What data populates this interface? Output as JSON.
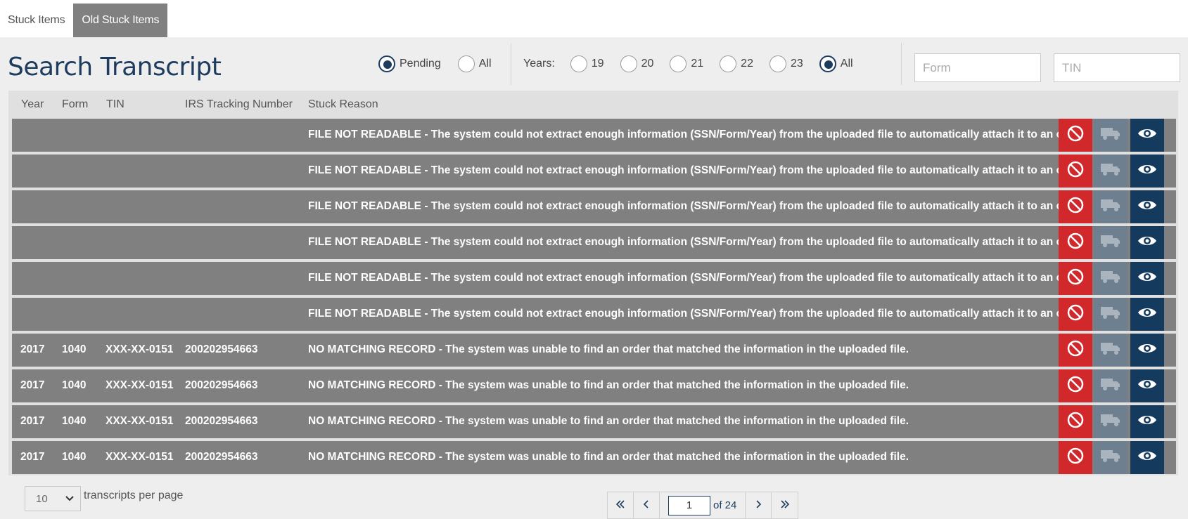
{
  "tabs": [
    {
      "label": "Stuck Items",
      "active": false
    },
    {
      "label": "Old Stuck Items",
      "active": true
    }
  ],
  "title": "Search Transcript",
  "status_filter": {
    "options": [
      "Pending",
      "All"
    ],
    "selected": "Pending"
  },
  "years_filter": {
    "label": "Years:",
    "options": [
      "19",
      "20",
      "21",
      "22",
      "23",
      "All"
    ],
    "selected": "All"
  },
  "form_input": {
    "placeholder": "Form",
    "value": ""
  },
  "tin_input": {
    "placeholder": "TIN",
    "value": ""
  },
  "table": {
    "headers": {
      "year": "Year",
      "form": "Form",
      "tin": "TIN",
      "tracking": "IRS Tracking Number",
      "reason": "Stuck Reason"
    },
    "rows": [
      {
        "year": "",
        "form": "",
        "tin": "",
        "tracking": "",
        "reason": "FILE NOT READABLE - The system could not extract enough information (SSN/Form/Year) from the uploaded file to automatically attach it to an order."
      },
      {
        "year": "",
        "form": "",
        "tin": "",
        "tracking": "",
        "reason": "FILE NOT READABLE - The system could not extract enough information (SSN/Form/Year) from the uploaded file to automatically attach it to an order."
      },
      {
        "year": "",
        "form": "",
        "tin": "",
        "tracking": "",
        "reason": "FILE NOT READABLE - The system could not extract enough information (SSN/Form/Year) from the uploaded file to automatically attach it to an order."
      },
      {
        "year": "",
        "form": "",
        "tin": "",
        "tracking": "",
        "reason": "FILE NOT READABLE - The system could not extract enough information (SSN/Form/Year) from the uploaded file to automatically attach it to an order."
      },
      {
        "year": "",
        "form": "",
        "tin": "",
        "tracking": "",
        "reason": "FILE NOT READABLE - The system could not extract enough information (SSN/Form/Year) from the uploaded file to automatically attach it to an order."
      },
      {
        "year": "",
        "form": "",
        "tin": "",
        "tracking": "",
        "reason": "FILE NOT READABLE - The system could not extract enough information (SSN/Form/Year) from the uploaded file to automatically attach it to an order."
      },
      {
        "year": "2017",
        "form": "1040",
        "tin": "XXX-XX-0151",
        "tracking": "200202954663",
        "reason": "NO MATCHING RECORD - The system was unable to find an order that matched the information in the uploaded file."
      },
      {
        "year": "2017",
        "form": "1040",
        "tin": "XXX-XX-0151",
        "tracking": "200202954663",
        "reason": "NO MATCHING RECORD - The system was unable to find an order that matched the information in the uploaded file."
      },
      {
        "year": "2017",
        "form": "1040",
        "tin": "XXX-XX-0151",
        "tracking": "200202954663",
        "reason": "NO MATCHING RECORD - The system was unable to find an order that matched the information in the uploaded file."
      },
      {
        "year": "2017",
        "form": "1040",
        "tin": "XXX-XX-0151",
        "tracking": "200202954663",
        "reason": "NO MATCHING RECORD - The system was unable to find an order that matched the information in the uploaded file."
      }
    ],
    "row_actions": [
      "block-icon",
      "truck-icon",
      "eye-icon"
    ]
  },
  "pagination": {
    "per_page": "10",
    "per_page_label": "transcripts per page",
    "current_page": "1",
    "of_label": "of 24"
  },
  "colors": {
    "accent": "#1d3c5e",
    "row_bg": "#808080",
    "danger": "#d0282b",
    "muted_btn": "#6e7f90",
    "view_btn": "#143a5e"
  }
}
